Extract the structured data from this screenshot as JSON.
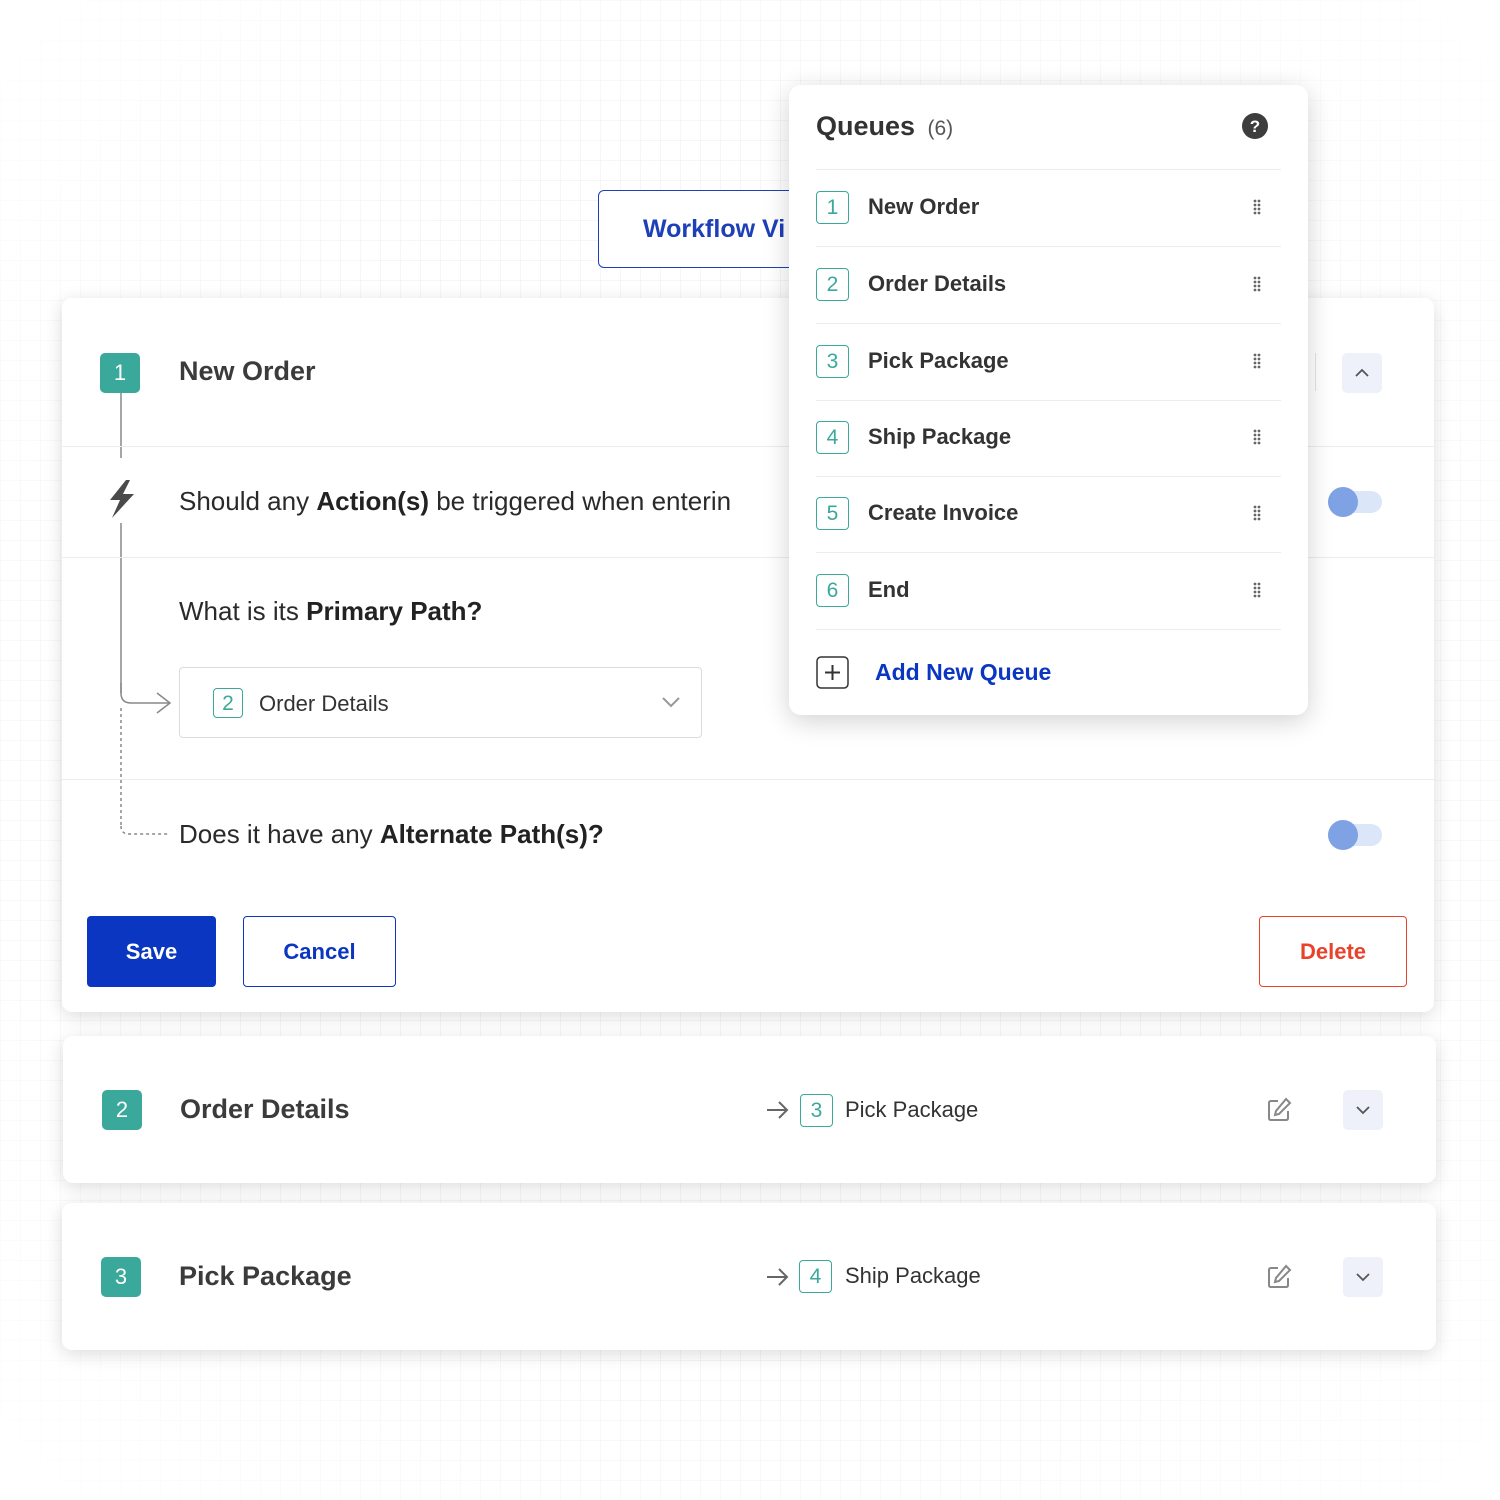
{
  "workflow_tab": {
    "label": "Workflow Vi"
  },
  "editor": {
    "step_number": "1",
    "title": "New Order",
    "actions_question": {
      "pre": "Should any ",
      "bold": "Action(s)",
      "post": " be triggered when enterin"
    },
    "primary_path_question": {
      "pre": "What is its ",
      "bold": "Primary Path?"
    },
    "primary_path_select": {
      "number": "2",
      "value": "Order Details"
    },
    "alternate_question": {
      "pre": "Does it have any ",
      "bold": "Alternate Path(s)?"
    },
    "save_label": "Save",
    "cancel_label": "Cancel",
    "delete_label": "Delete"
  },
  "steps": [
    {
      "number": "2",
      "title": "Order Details",
      "next_number": "3",
      "next_title": "Pick Package"
    },
    {
      "number": "3",
      "title": "Pick Package",
      "next_number": "4",
      "next_title": "Ship Package"
    }
  ],
  "queues": {
    "title": "Queues",
    "count": "(6)",
    "items": [
      {
        "number": "1",
        "label": "New Order"
      },
      {
        "number": "2",
        "label": "Order Details"
      },
      {
        "number": "3",
        "label": "Pick Package"
      },
      {
        "number": "4",
        "label": "Ship Package"
      },
      {
        "number": "5",
        "label": "Create Invoice"
      },
      {
        "number": "6",
        "label": "End"
      }
    ],
    "add_label": "Add New Queue"
  },
  "colors": {
    "primary": "#0a36c2",
    "teal": "#3aa89a",
    "danger": "#e8422b"
  },
  "icons": [
    "help-icon",
    "drag-handle-icon",
    "lightning-icon",
    "chevron-up-icon",
    "chevron-down-icon",
    "edit-icon",
    "arrow-right-icon",
    "plus-icon"
  ]
}
